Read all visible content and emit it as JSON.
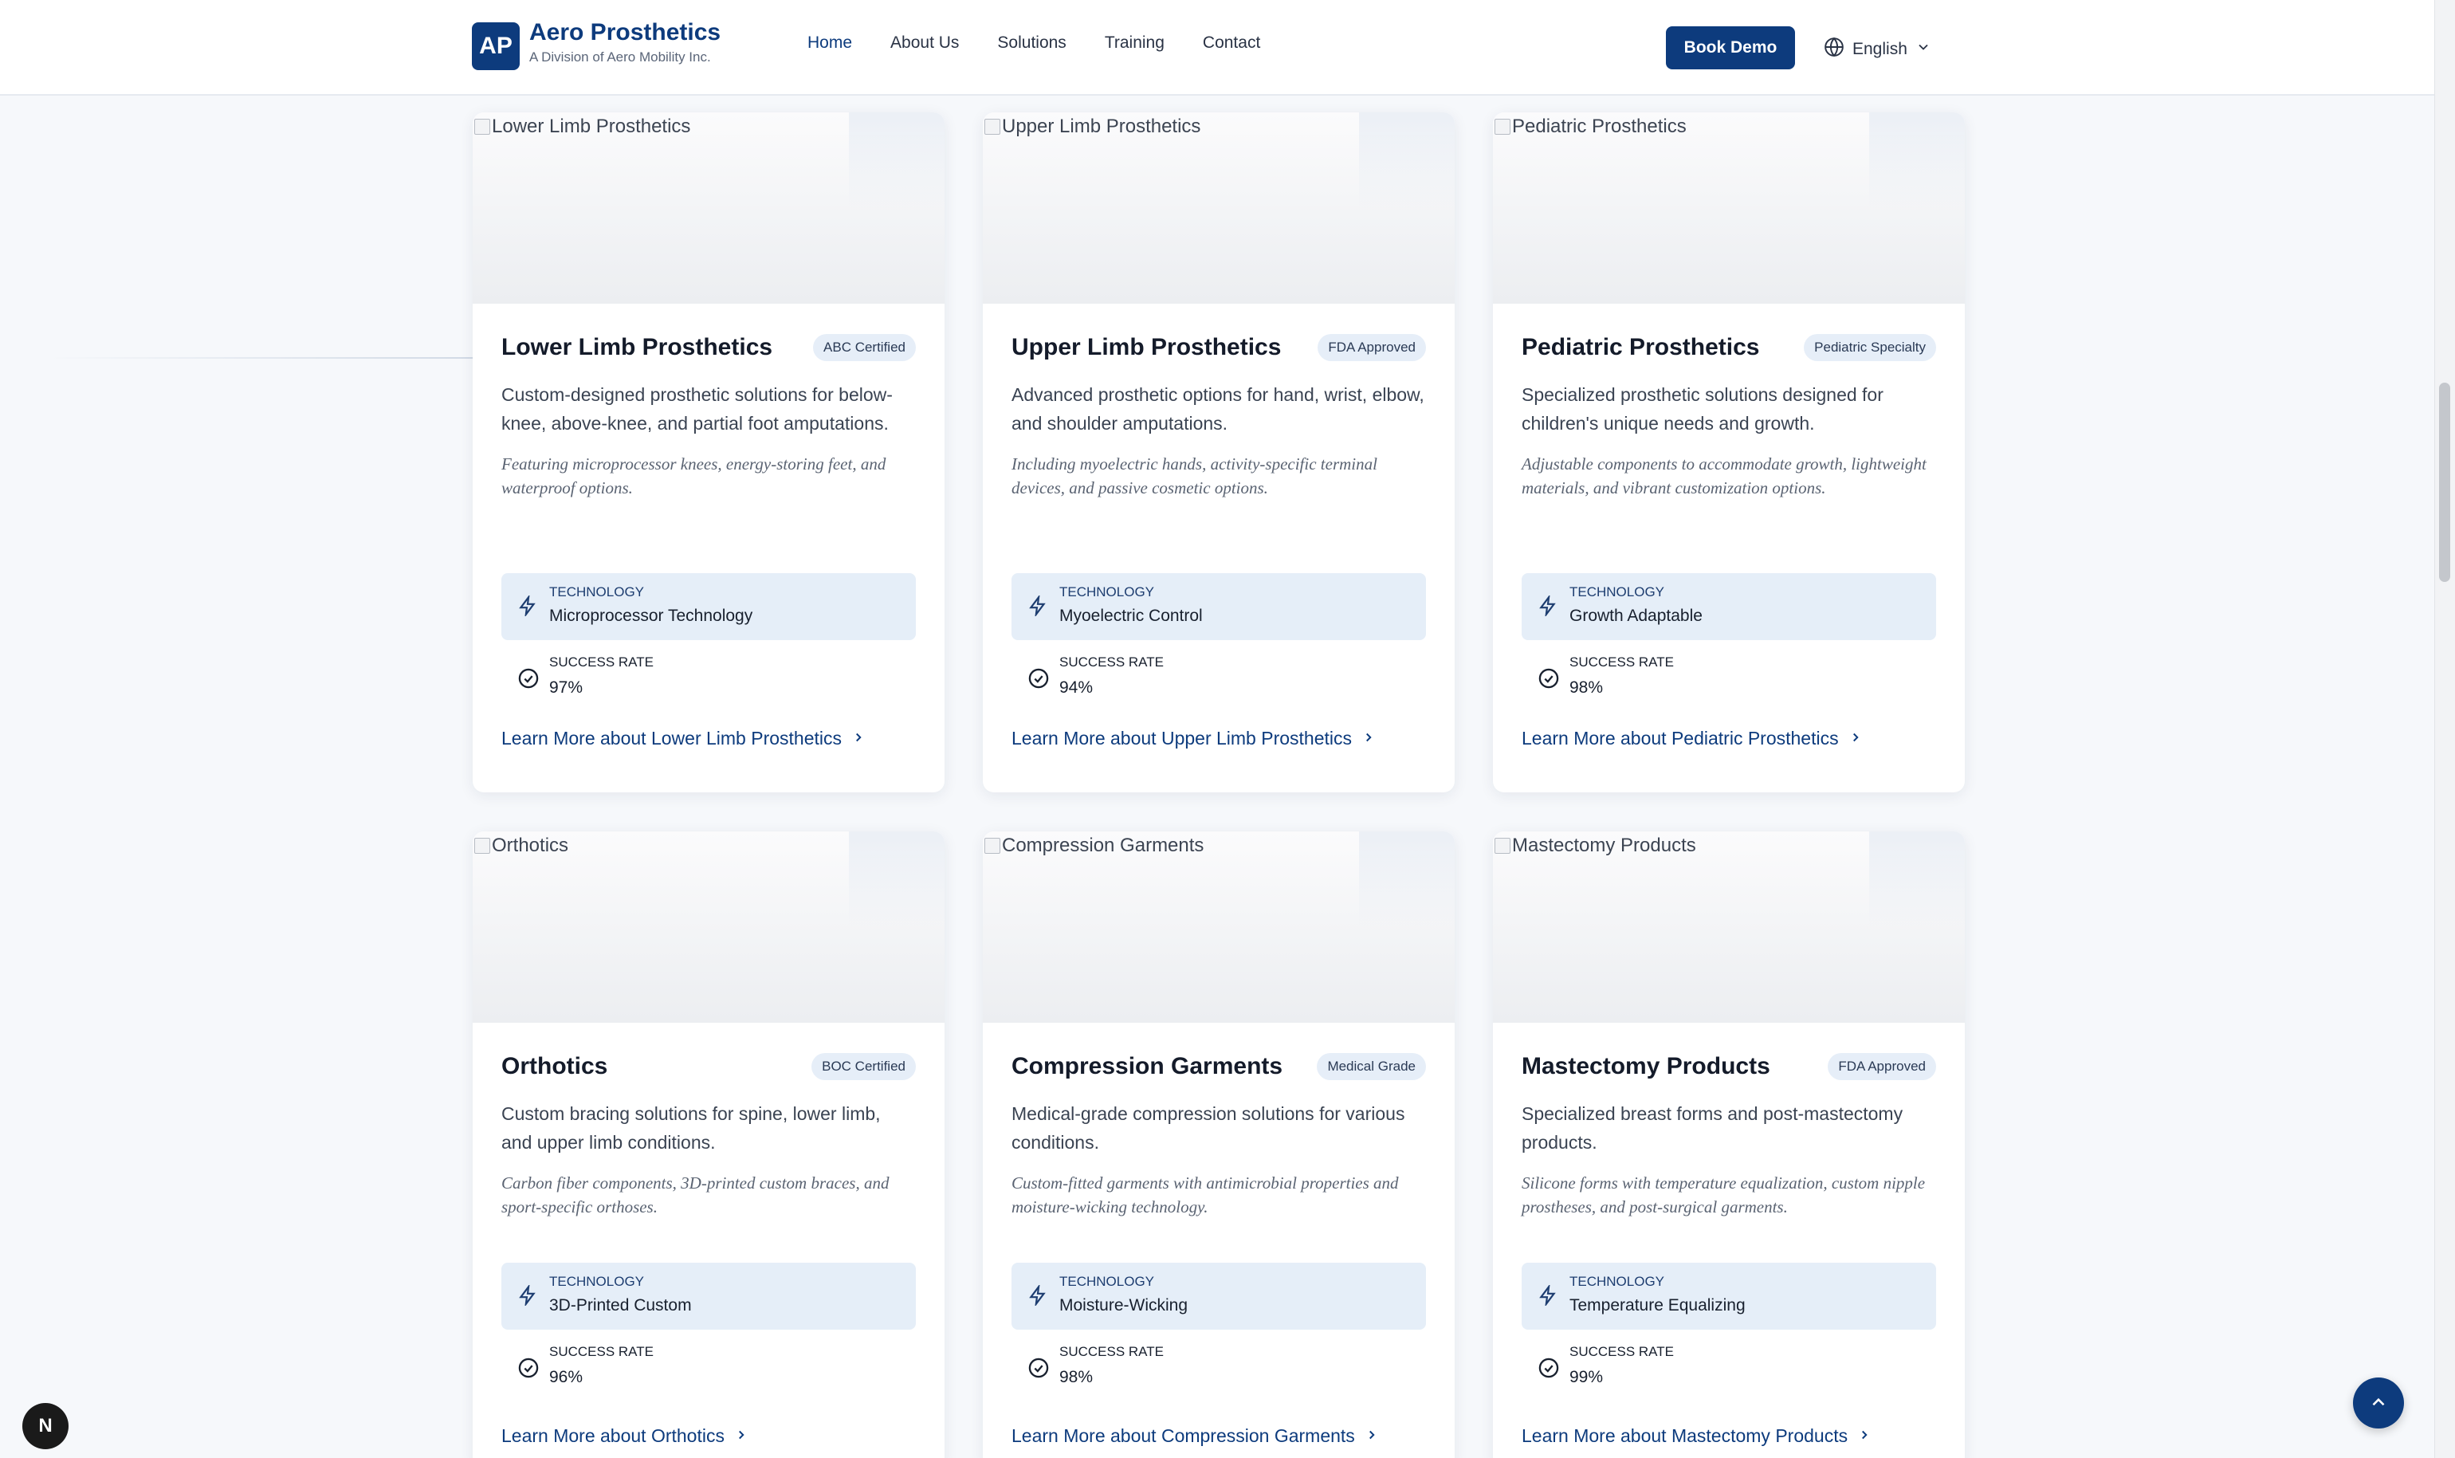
{
  "header": {
    "logo_text": "AP",
    "brand_name": "Aero Prosthetics",
    "brand_sub": "A Division of Aero Mobility Inc.",
    "nav": [
      {
        "label": "Home",
        "active": true
      },
      {
        "label": "About Us",
        "active": false
      },
      {
        "label": "Solutions",
        "active": false
      },
      {
        "label": "Training",
        "active": false
      },
      {
        "label": "Contact",
        "active": false
      }
    ],
    "book_demo": "Book Demo",
    "language": "English"
  },
  "cards": [
    {
      "image_alt": "Lower Limb Prosthetics",
      "title": "Lower Limb Prosthetics",
      "badge": "ABC Certified",
      "description": "Custom-designed prosthetic solutions for below-knee, above-knee, and partial foot amputations.",
      "note": "Featuring microprocessor knees, energy-storing feet, and waterproof options.",
      "tech_label": "TECHNOLOGY",
      "tech_value": "Microprocessor Technology",
      "success_label": "SUCCESS RATE",
      "success_value": "97%",
      "learn_more": "Learn More about Lower Limb Prosthetics"
    },
    {
      "image_alt": "Upper Limb Prosthetics",
      "title": "Upper Limb Prosthetics",
      "badge": "FDA Approved",
      "description": "Advanced prosthetic options for hand, wrist, elbow, and shoulder amputations.",
      "note": "Including myoelectric hands, activity-specific terminal devices, and passive cosmetic options.",
      "tech_label": "TECHNOLOGY",
      "tech_value": "Myoelectric Control",
      "success_label": "SUCCESS RATE",
      "success_value": "94%",
      "learn_more": "Learn More about Upper Limb Prosthetics"
    },
    {
      "image_alt": "Pediatric Prosthetics",
      "title": "Pediatric Prosthetics",
      "badge": "Pediatric Specialty",
      "description": "Specialized prosthetic solutions designed for children's unique needs and growth.",
      "note": "Adjustable components to accommodate growth, lightweight materials, and vibrant customization options.",
      "tech_label": "TECHNOLOGY",
      "tech_value": "Growth Adaptable",
      "success_label": "SUCCESS RATE",
      "success_value": "98%",
      "learn_more": "Learn More about Pediatric Prosthetics"
    },
    {
      "image_alt": "Orthotics",
      "title": "Orthotics",
      "badge": "BOC Certified",
      "description": "Custom bracing solutions for spine, lower limb, and upper limb conditions.",
      "note": "Carbon fiber components, 3D-printed custom braces, and sport-specific orthoses.",
      "tech_label": "TECHNOLOGY",
      "tech_value": "3D-Printed Custom",
      "success_label": "SUCCESS RATE",
      "success_value": "96%",
      "learn_more": "Learn More about Orthotics"
    },
    {
      "image_alt": "Compression Garments",
      "title": "Compression Garments",
      "badge": "Medical Grade",
      "description": "Medical-grade compression solutions for various conditions.",
      "note": "Custom-fitted garments with antimicrobial properties and moisture-wicking technology.",
      "tech_label": "TECHNOLOGY",
      "tech_value": "Moisture-Wicking",
      "success_label": "SUCCESS RATE",
      "success_value": "98%",
      "learn_more": "Learn More about Compression Garments"
    },
    {
      "image_alt": "Mastectomy Products",
      "title": "Mastectomy Products",
      "badge": "FDA Approved",
      "description": "Specialized breast forms and post-mastectomy products.",
      "note": "Silicone forms with temperature equalization, custom nipple prostheses, and post-surgical garments.",
      "tech_label": "TECHNOLOGY",
      "tech_value": "Temperature Equalizing",
      "success_label": "SUCCESS RATE",
      "success_value": "99%",
      "learn_more": "Learn More about Mastectomy Products"
    }
  ],
  "floating": {
    "dev_badge": "N"
  },
  "colors": {
    "brand": "#0d3b7d",
    "tech_bg": "#e5eef8",
    "page_bg": "#f6f8fb"
  },
  "icons": {
    "technology": "lightning-icon",
    "success": "check-circle-icon",
    "learn_more": "chevron-right-icon",
    "language": "globe-icon",
    "scroll_top": "chevron-up-icon"
  }
}
